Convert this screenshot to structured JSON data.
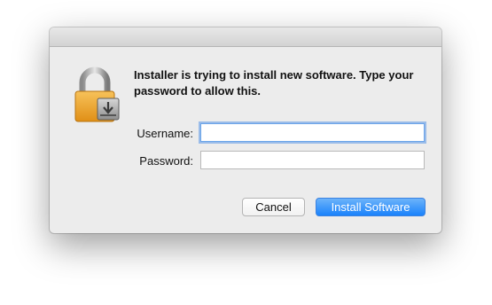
{
  "window": {
    "title": ""
  },
  "dialog": {
    "message": "Installer is trying to install new software. Type your password to allow this.",
    "icon": "lock-icon"
  },
  "form": {
    "username_label": "Username:",
    "username_value": "",
    "password_label": "Password:",
    "password_value": ""
  },
  "buttons": {
    "cancel_label": "Cancel",
    "install_label": "Install Software"
  },
  "colors": {
    "accent": "#1a82fb",
    "focus_ring": "#6fa3e8",
    "dialog_bg": "#ececec"
  }
}
